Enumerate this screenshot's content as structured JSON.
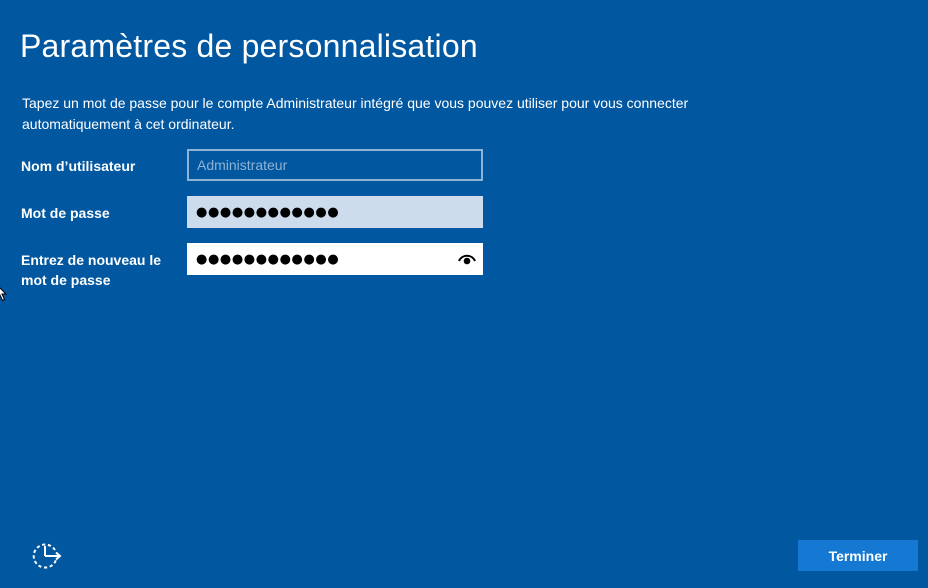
{
  "page": {
    "title": "Paramètres de personnalisation",
    "description": "Tapez un mot de passe pour le compte Administrateur intégré que vous pouvez utiliser pour vous connecter automatiquement à cet ordinateur."
  },
  "form": {
    "username": {
      "label": "Nom d’utilisateur",
      "placeholder": "Administrateur"
    },
    "password": {
      "label": "Mot de passe",
      "masked_value": "●●●●●●●●●●●●"
    },
    "confirm": {
      "label": "Entrez de nouveau le mot de passe",
      "masked_value": "●●●●●●●●●●●●"
    }
  },
  "footer": {
    "finish_label": "Terminer",
    "accessibility_icon": "ease-of-access-icon"
  },
  "colors": {
    "background": "#0157a0",
    "button": "#1578d3",
    "password_field": "#ccdcec",
    "confirm_field": "#ffffff",
    "username_border": "#8fb3d4"
  }
}
